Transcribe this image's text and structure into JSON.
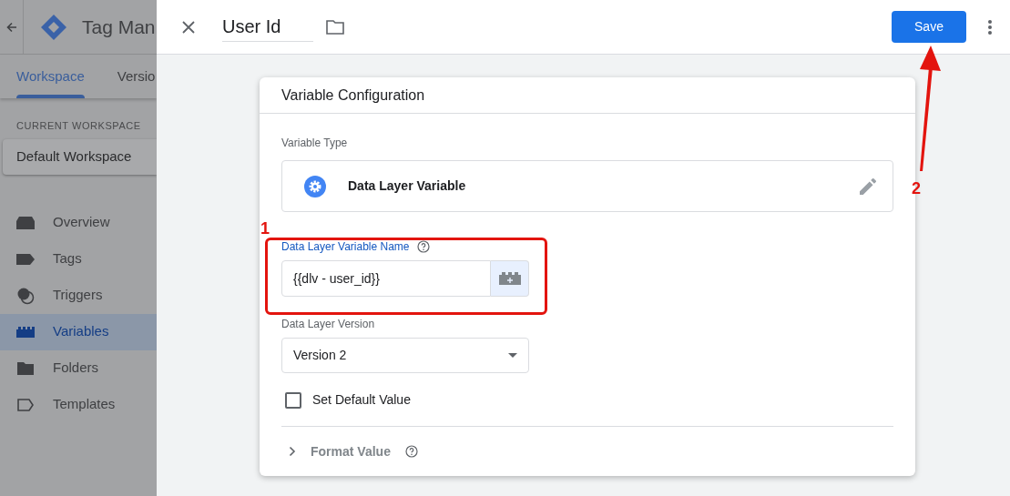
{
  "app": {
    "title": "Tag Man"
  },
  "tabs": [
    {
      "label": "Workspace",
      "selected": true
    },
    {
      "label": "Versio",
      "selected": false
    }
  ],
  "workspace": {
    "heading": "CURRENT WORKSPACE",
    "name": "Default Workspace"
  },
  "nav": [
    {
      "label": "Overview",
      "selected": false
    },
    {
      "label": "Tags",
      "selected": false
    },
    {
      "label": "Triggers",
      "selected": false
    },
    {
      "label": "Variables",
      "selected": true
    },
    {
      "label": "Folders",
      "selected": false
    },
    {
      "label": "Templates",
      "selected": false
    }
  ],
  "editor": {
    "name": "User Id",
    "save": "Save"
  },
  "card": {
    "title": "Variable Configuration",
    "type_label": "Variable Type",
    "type_name": "Data Layer Variable",
    "name_label": "Data Layer Variable Name",
    "name_value": "{{dlv - user_id}}",
    "version_label": "Data Layer Version",
    "version_value": "Version 2",
    "default_label": "Set Default Value",
    "default_checked": false,
    "format_label": "Format Value",
    "format_expanded": false
  },
  "annotations": [
    {
      "label": "1"
    },
    {
      "label": "2"
    }
  ]
}
